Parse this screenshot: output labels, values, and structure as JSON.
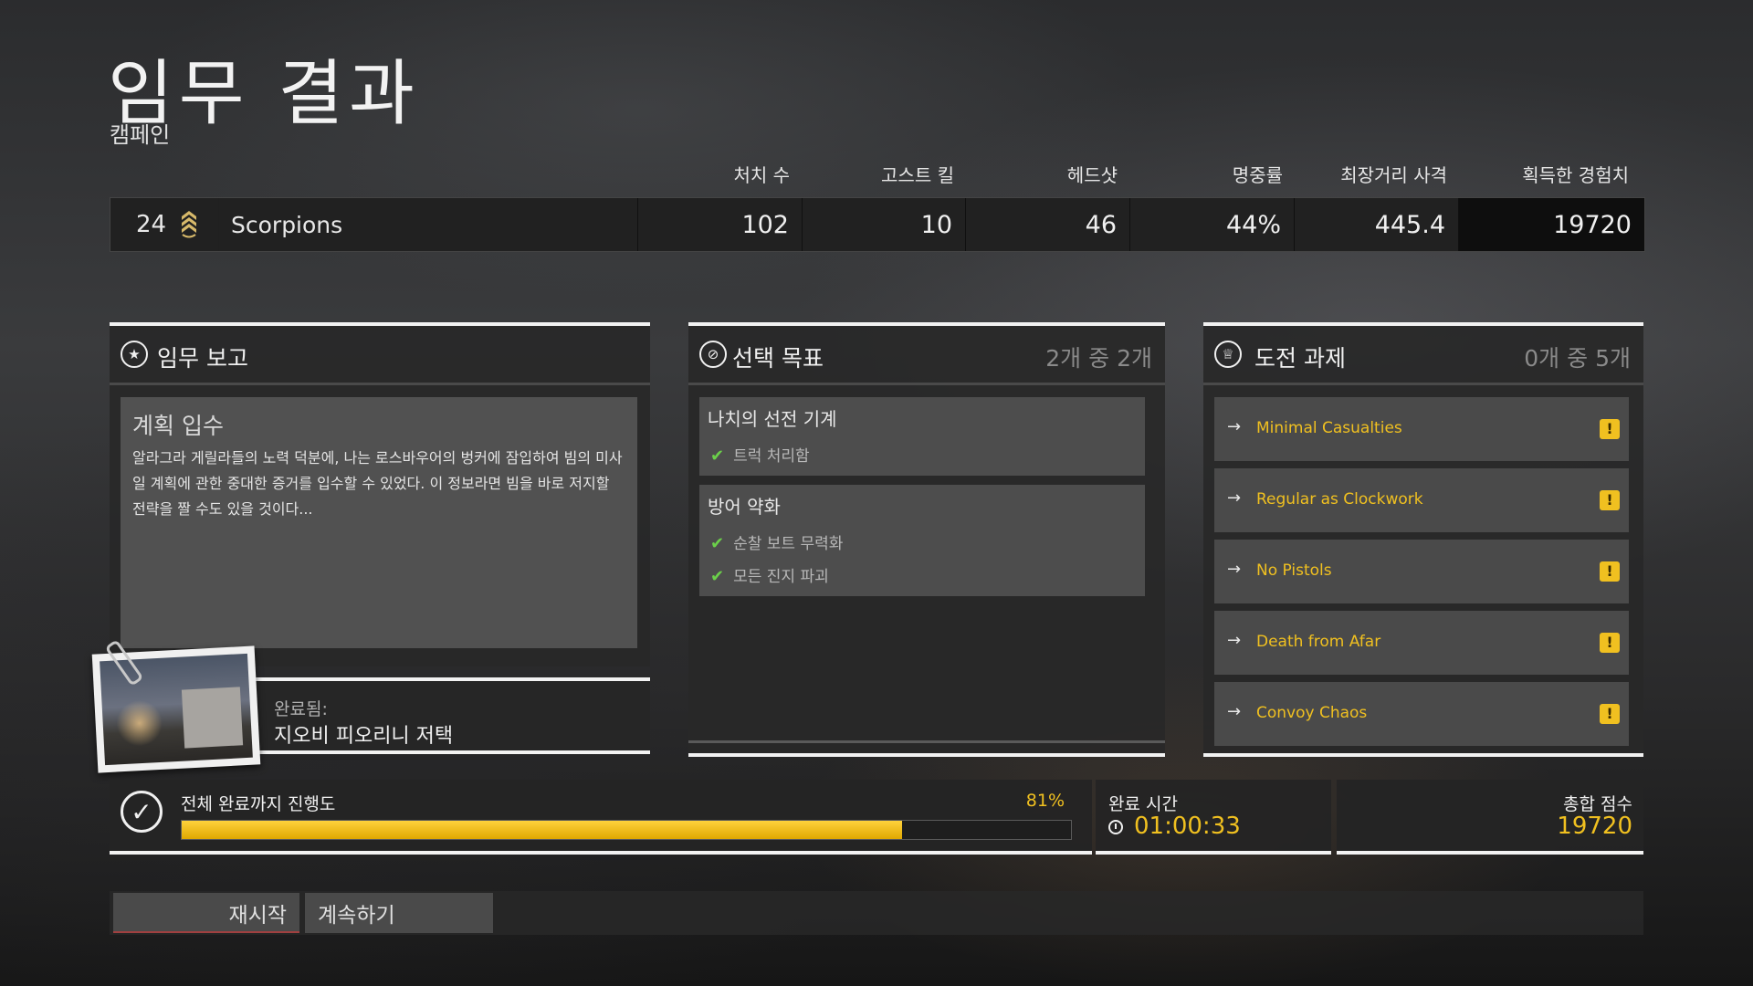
{
  "header": {
    "title": "임무 결과",
    "subtitle": "캠페인"
  },
  "stats": {
    "headers": [
      "처치 수",
      "고스트 킬",
      "헤드샷",
      "명중률",
      "최장거리 사격",
      "획득한 경험치"
    ],
    "player": {
      "rank": "24",
      "rank_icon": "sergeant-rank-icon",
      "name": "Scorpions",
      "values": [
        "102",
        "10",
        "46",
        "44%",
        "445.4",
        "19720"
      ]
    }
  },
  "mission_report": {
    "icon": "star-icon",
    "title": "임무 보고",
    "heading": "계획 입수",
    "body": "알라그라 게릴라들의 노력 덕분에, 나는 로스바우어의 벙커에 잠입하여 빔의 미사일 계획에 관한 중대한 증거를 입수할 수 있었다. 이 정보라면 빔을 바로 저지할 전략을 짤 수도 있을 것이다...",
    "completed_label": "완료됨:",
    "completed_location": "지오비 피오리니 저택"
  },
  "optional_objectives": {
    "icon": "compass-icon",
    "title": "선택 목표",
    "count": "2개 중 2개",
    "groups": [
      {
        "title": "나치의 선전 기계",
        "items": [
          "트럭 처리함"
        ]
      },
      {
        "title": "방어 약화",
        "items": [
          "순찰 보트 무력화",
          "모든 진지 파괴"
        ]
      }
    ]
  },
  "challenges": {
    "icon": "trophy-icon",
    "title": "도전 과제",
    "count": "0개 중 5개",
    "items": [
      "Minimal Casualties",
      "Regular as Clockwork",
      "No Pistols",
      "Death from Afar",
      "Convoy Chaos"
    ]
  },
  "progress": {
    "label": "전체 완료까지 진행도",
    "percent_text": "81%",
    "fraction": 0.81
  },
  "completion_time": {
    "label": "완료 시간",
    "value": "01:00:33"
  },
  "total_score": {
    "label": "총합 점수",
    "value": "19720"
  },
  "buttons": {
    "restart": "재시작",
    "continue": "계속하기"
  },
  "colors": {
    "accent": "#f0c020",
    "check": "#6bd04a",
    "progress_fill": "#f0c020"
  }
}
